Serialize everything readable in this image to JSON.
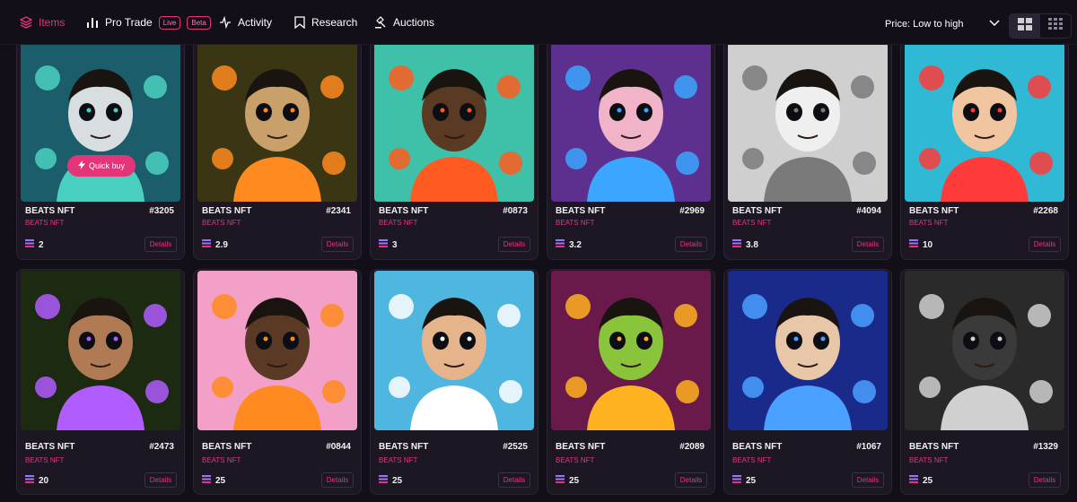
{
  "nav": {
    "items_label": "Items",
    "pro_trade_label": "Pro Trade",
    "live_badge": "Live",
    "beta_badge": "Beta",
    "activity_label": "Activity",
    "research_label": "Research",
    "auctions_label": "Auctions"
  },
  "sort": {
    "value": "Price: Low to high"
  },
  "card_common": {
    "collection": "BEATS NFT",
    "details_label": "Details",
    "quick_buy_label": "Quick buy"
  },
  "cards": [
    {
      "name": "BEATS NFT",
      "number": "#3205",
      "price": "2",
      "bg": "#1b5d6b",
      "face": "#d8dde0",
      "accent": "#4ad0c0"
    },
    {
      "name": "BEATS NFT",
      "number": "#2341",
      "price": "2.9",
      "bg": "#3a3512",
      "face": "#c9a06a",
      "accent": "#ff8a1f"
    },
    {
      "name": "BEATS NFT",
      "number": "#0873",
      "price": "3",
      "bg": "#3ec1a8",
      "face": "#5a3a22",
      "accent": "#ff5a1f"
    },
    {
      "name": "BEATS NFT",
      "number": "#2969",
      "price": "3.2",
      "bg": "#5d2f8f",
      "face": "#f1b3c8",
      "accent": "#3aa6ff"
    },
    {
      "name": "BEATS NFT",
      "number": "#4094",
      "price": "3.8",
      "bg": "#cfcfcf",
      "face": "#efefef",
      "accent": "#7a7a7a"
    },
    {
      "name": "BEATS NFT",
      "number": "#2268",
      "price": "10",
      "bg": "#2fb9d4",
      "face": "#f1c5a0",
      "accent": "#ff3a3a"
    },
    {
      "name": "BEATS NFT",
      "number": "#2473",
      "price": "20",
      "bg": "#1d2a12",
      "face": "#b07a55",
      "accent": "#b05cff"
    },
    {
      "name": "BEATS NFT",
      "number": "#0844",
      "price": "25",
      "bg": "#f3a0c8",
      "face": "#5a3a24",
      "accent": "#ff8a1f"
    },
    {
      "name": "BEATS NFT",
      "number": "#2525",
      "price": "25",
      "bg": "#4fb6e0",
      "face": "#e5b48a",
      "accent": "#ffffff"
    },
    {
      "name": "BEATS NFT",
      "number": "#2089",
      "price": "25",
      "bg": "#6a1a4a",
      "face": "#8ac43a",
      "accent": "#ffb21f"
    },
    {
      "name": "BEATS NFT",
      "number": "#1067",
      "price": "25",
      "bg": "#1a2a8a",
      "face": "#e8c6a8",
      "accent": "#4aa0ff"
    },
    {
      "name": "BEATS NFT",
      "number": "#1329",
      "price": "25",
      "bg": "#2a2a2a",
      "face": "#3a3a3a",
      "accent": "#d0d0d0"
    }
  ]
}
